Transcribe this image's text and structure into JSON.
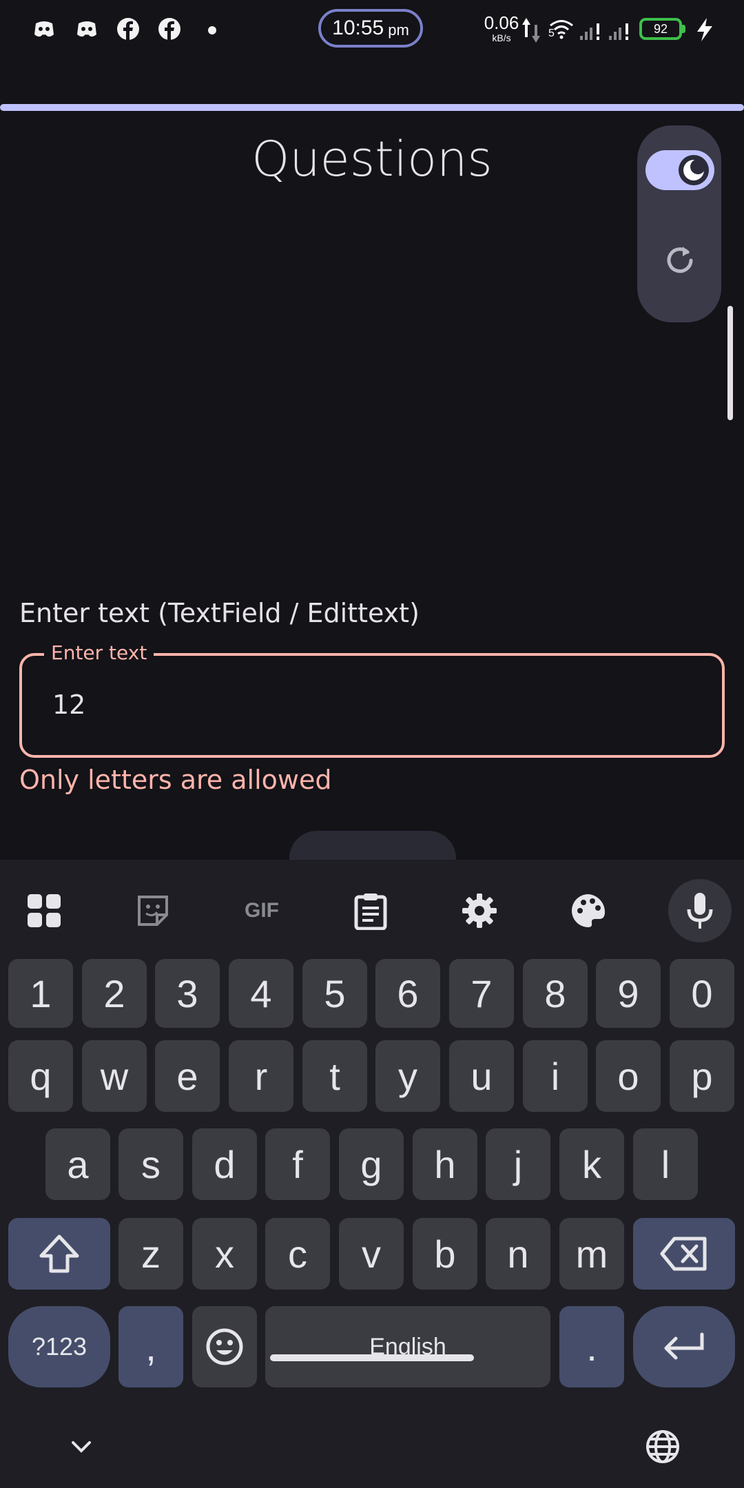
{
  "status_bar": {
    "time": "10:55",
    "ampm": "pm",
    "net_speed": "0.06",
    "net_unit": "kB/s",
    "signal_label": "5",
    "battery": "92",
    "icons": [
      "discord-icon",
      "discord-icon",
      "facebook-icon",
      "facebook-icon",
      "dot-icon",
      "upload-arrow-icon",
      "download-arrow-icon",
      "wifi-icon",
      "signal-icon",
      "signal-icon",
      "charging-icon"
    ]
  },
  "app": {
    "title": "Questions",
    "progress": 1.0,
    "theme_toggle_on": true,
    "section_label": "Enter text (TextField / Edittext)",
    "input": {
      "label": "Enter text",
      "value": "12"
    },
    "error": "Only letters are allowed"
  },
  "keyboard": {
    "toolbar": [
      "apps-grid-icon",
      "sticker-icon",
      "gif-icon",
      "clipboard-icon",
      "settings-icon",
      "palette-icon",
      "mic-icon"
    ],
    "toolbar_gif_text": "GIF",
    "row_numbers": [
      "1",
      "2",
      "3",
      "4",
      "5",
      "6",
      "7",
      "8",
      "9",
      "0"
    ],
    "row_1": [
      "q",
      "w",
      "e",
      "r",
      "t",
      "y",
      "u",
      "i",
      "o",
      "p"
    ],
    "row_2": [
      "a",
      "s",
      "d",
      "f",
      "g",
      "h",
      "j",
      "k",
      "l"
    ],
    "row_3": [
      "z",
      "x",
      "c",
      "v",
      "b",
      "n",
      "m"
    ],
    "symbols_key": "?123",
    "comma_key": ",",
    "space_key": "English",
    "period_key": ".",
    "shift": "shift-icon",
    "backspace": "backspace-icon",
    "enter": "enter-icon",
    "emoji": "emoji-icon",
    "collapse": "chevron-down-icon",
    "language": "globe-icon"
  },
  "colors": {
    "background": "#131318",
    "accent": "#bfc2ff",
    "error": "#ffb4ab",
    "keyboard_bg": "#1e1e24",
    "key_bg": "#3b3b42",
    "func_key_bg": "#454d6a",
    "battery_green": "#3fbf4a"
  }
}
